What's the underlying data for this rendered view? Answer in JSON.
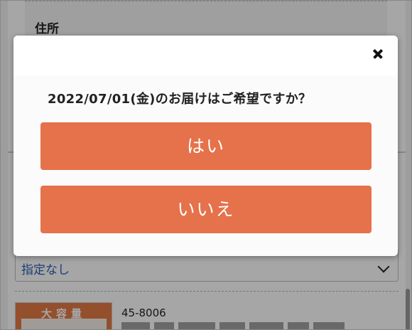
{
  "background": {
    "address_label": "住所",
    "select_value": "指定なし",
    "product_badge": "大容量",
    "product_code": "45-8006"
  },
  "modal": {
    "question": "2022/07/01(金)のお届けはご希望ですか？",
    "yes_label": "はい",
    "no_label": "いいえ",
    "close_icon": "close-icon"
  },
  "colors": {
    "accent": "#e5724a",
    "link": "#2a5fb3",
    "overlay": "rgba(0,0,0,0.35)"
  }
}
